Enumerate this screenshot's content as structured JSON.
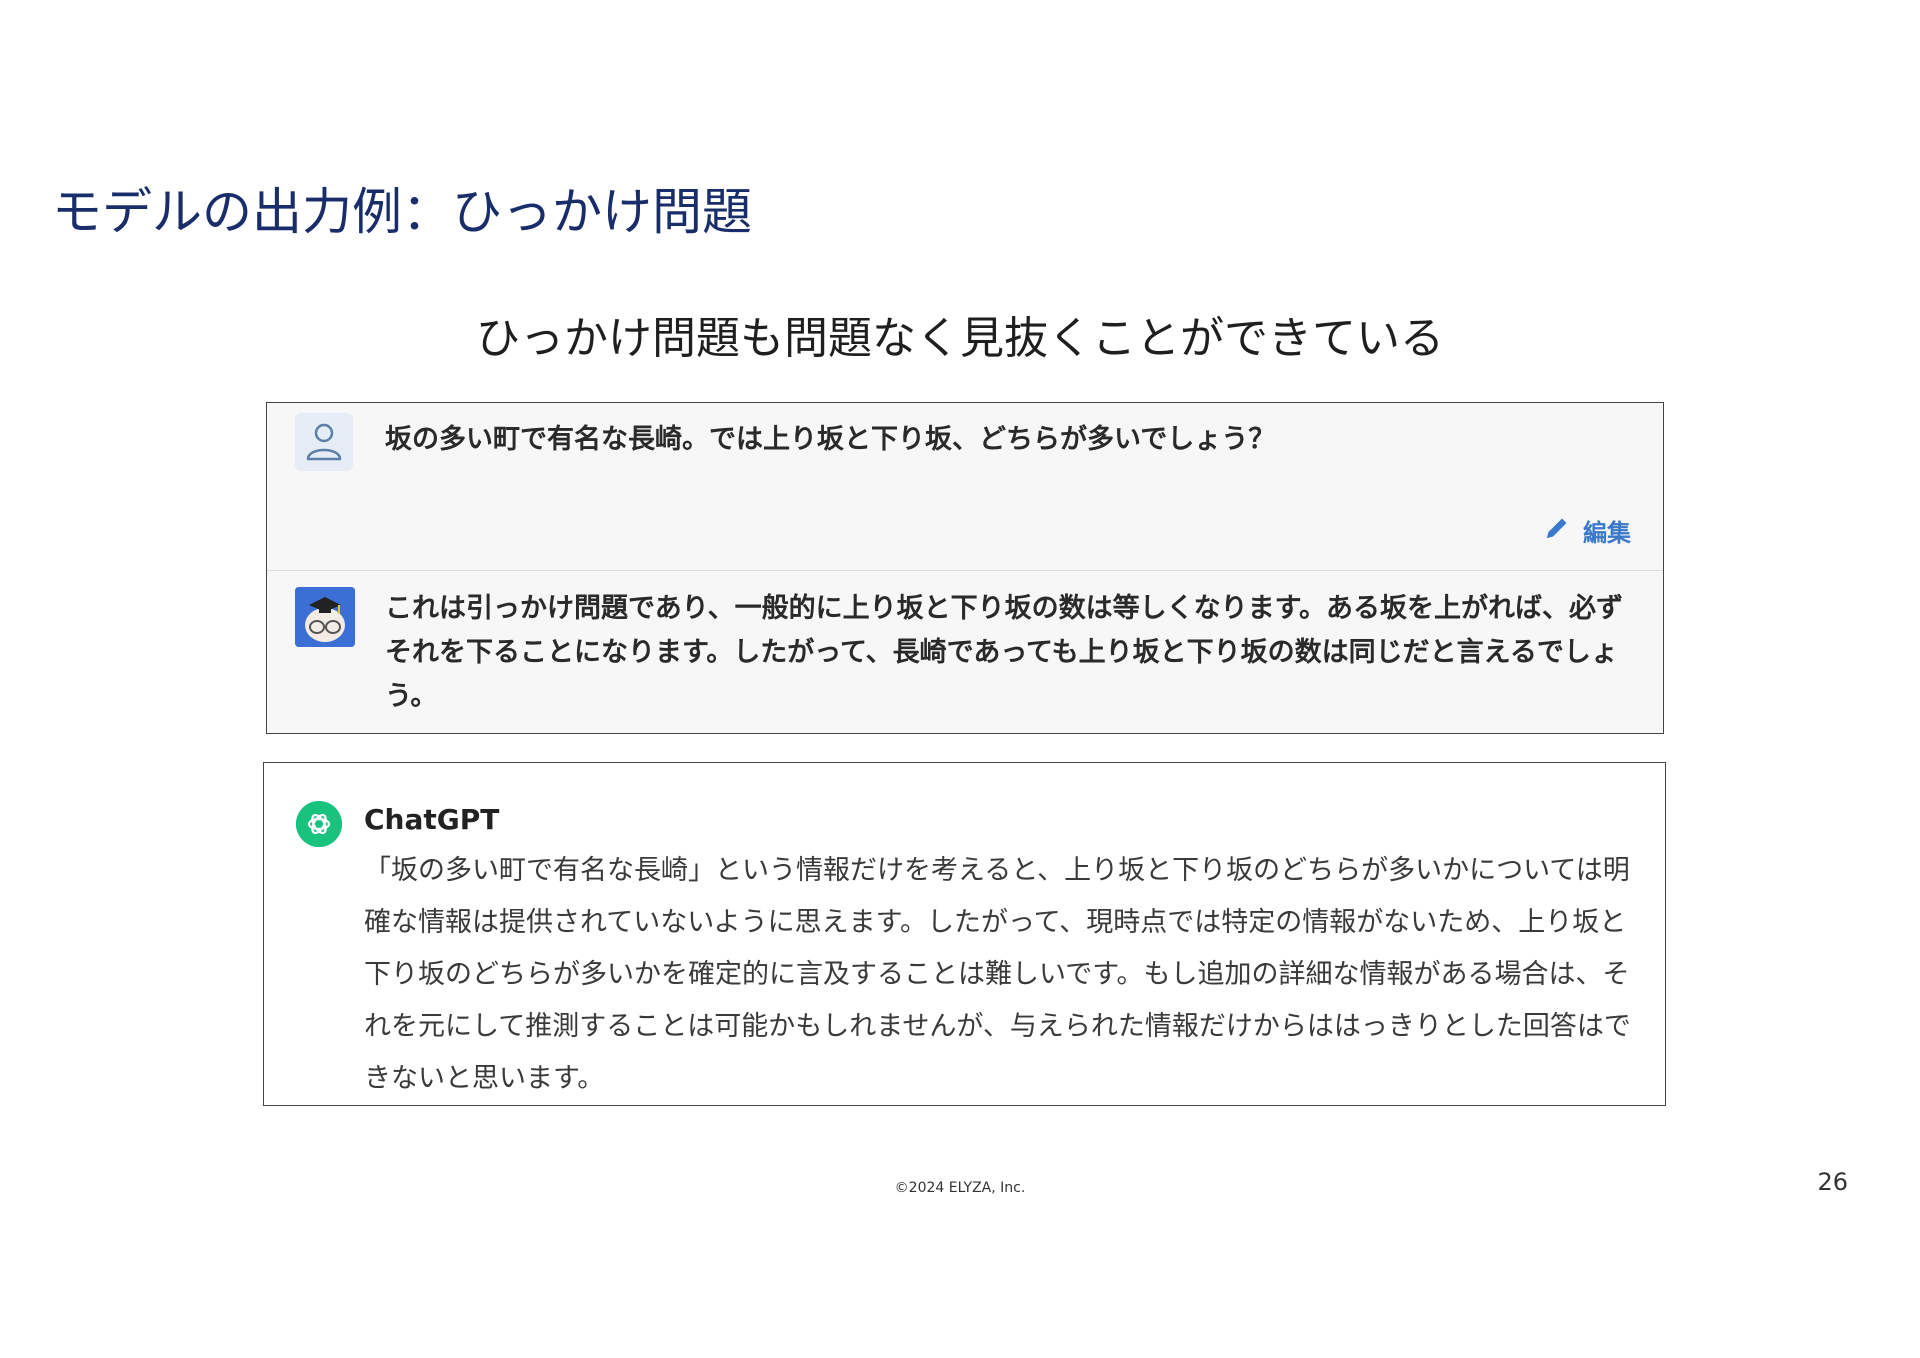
{
  "slide": {
    "title": "モデルの出力例：ひっかけ問題",
    "subtitle": "ひっかけ問題も問題なく見抜くことができている"
  },
  "elyza_chat": {
    "user_avatar_icon": "user-outline-icon",
    "user_message": "坂の多い町で有名な長崎。では上り坂と下り坂、どちらが多いでしょう？",
    "edit_icon": "pencil-icon",
    "edit_label": "編集",
    "bot_avatar_icon": "graduate-mascot-icon",
    "bot_message": "これは引っかけ問題であり、一般的に上り坂と下り坂の数は等しくなります。ある坂を上がれば、必ずそれを下ることになります。したがって、長崎であっても上り坂と下り坂の数は同じだと言えるでしょう。"
  },
  "chatgpt": {
    "logo_icon": "openai-logo-icon",
    "name": "ChatGPT",
    "message": "「坂の多い町で有名な長崎」という情報だけを考えると、上り坂と下り坂のどちらが多いかについては明確な情報は提供されていないように思えます。したがって、現時点では特定の情報がないため、上り坂と下り坂のどちらが多いかを確定的に言及することは難しいです。もし追加の詳細な情報がある場合は、それを元にして推測することは可能かもしれませんが、与えられた情報だけからははっきりとした回答はできないと思います。"
  },
  "footer": {
    "copyright": "©2024 ELYZA, Inc.",
    "page_number": "26"
  },
  "colors": {
    "title": "#1a2d6b",
    "edit_link": "#3a78c9",
    "chatgpt_green": "#19c37d",
    "bot_avatar_bg": "#3b6fd6"
  }
}
